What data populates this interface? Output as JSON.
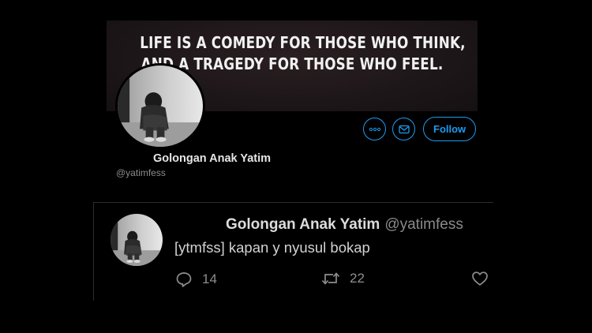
{
  "profile": {
    "banner_quote": [
      "LIFE IS A COMEDY FOR THOSE WHO THINK,",
      "AND A TRAGEDY FOR THOSE WHO FEEL."
    ],
    "display_name": "Golongan Anak Yatim",
    "handle": "@yatimfess",
    "more_icon": "more-horizontal-icon",
    "message_icon": "mail-icon",
    "follow_label": "Follow",
    "accent_color": "#1d9bf0"
  },
  "tweet": {
    "display_name": "Golongan Anak Yatim",
    "handle": "@yatimfess",
    "text": "[ytmfss] kapan y nyusul bokap",
    "reply_count": "14",
    "retweet_count": "22",
    "reply_icon": "reply-icon",
    "retweet_icon": "retweet-icon",
    "like_icon": "heart-icon"
  }
}
